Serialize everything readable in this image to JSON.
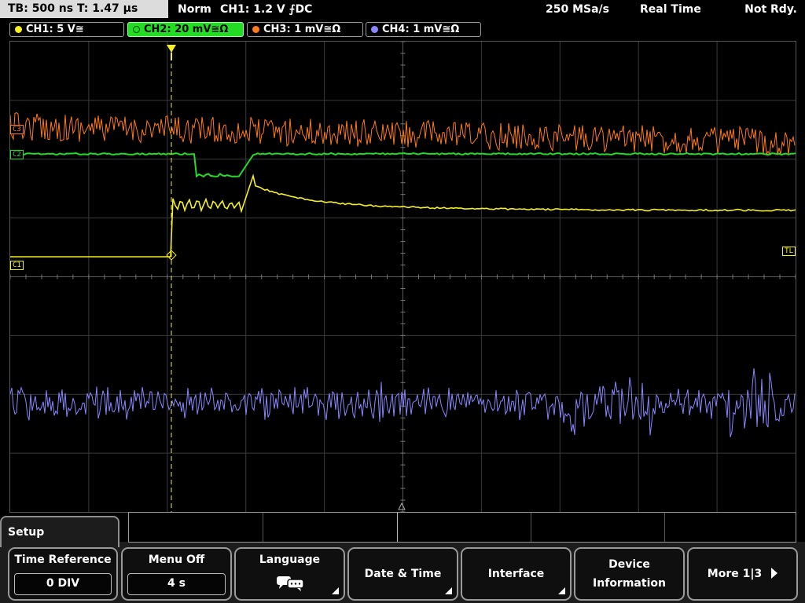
{
  "status": {
    "timebase": "TB: 500 ns  T: 1.47 µs",
    "mode": "Norm",
    "trigger": "CH1: 1.2 V ⨍DC",
    "sample_rate": "250 MSa/s",
    "acq_mode": "Real Time",
    "state": "Not Rdy."
  },
  "channels": [
    {
      "label": "CH1: 5 V≅",
      "color": "#f5f020"
    },
    {
      "label": "CH2: 20 mV≅Ω",
      "color": "#22dd22"
    },
    {
      "label": "CH3: 1 mV≅Ω",
      "color": "#ff7a1a"
    },
    {
      "label": "CH4: 1 mV≅Ω",
      "color": "#8a86ff"
    }
  ],
  "markers": {
    "c3": "C3",
    "c2": "C2",
    "c1": "C1",
    "tl": "TL"
  },
  "menu": {
    "title": "Setup",
    "keys": [
      {
        "label": "Time Reference",
        "value": "0 DIV"
      },
      {
        "label": "Menu Off",
        "value": "4 s"
      },
      {
        "label": "Language",
        "icon": "speech-bubble-icon"
      },
      {
        "label": "Date & Time"
      },
      {
        "label": "Interface"
      },
      {
        "label_line1": "Device",
        "label_line2": "Information"
      },
      {
        "label": "More 1|3"
      }
    ]
  }
}
